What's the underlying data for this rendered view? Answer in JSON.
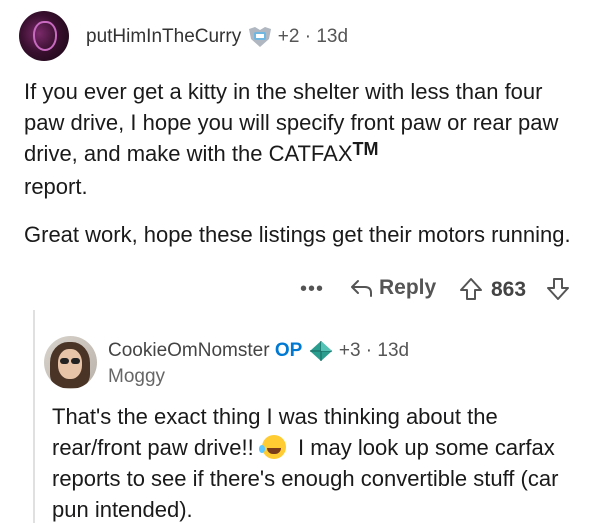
{
  "comment": {
    "username": "putHimInTheCurry",
    "award_count": "+2",
    "age": "13d",
    "body": [
      "If you ever get a kitty in the shelter with less than four paw drive, I hope you will specify front paw or rear paw drive, and make with the CATFAX",
      "Great work, hope these listings get their motors running."
    ],
    "trademark": "TM",
    "actions": {
      "more": "•••",
      "reply_label": "Reply",
      "score": "863"
    }
  },
  "reply": {
    "username": "CookieOmNomster",
    "op_label": "OP",
    "award_count": "+3",
    "age": "13d",
    "flair": "Moggy",
    "body_part1": "That's the exact thing I was thinking about the rear/front paw drive!!",
    "body_part2": "I may look up some carfax reports to see if there's enough convertible stuff (car pun intended)."
  }
}
